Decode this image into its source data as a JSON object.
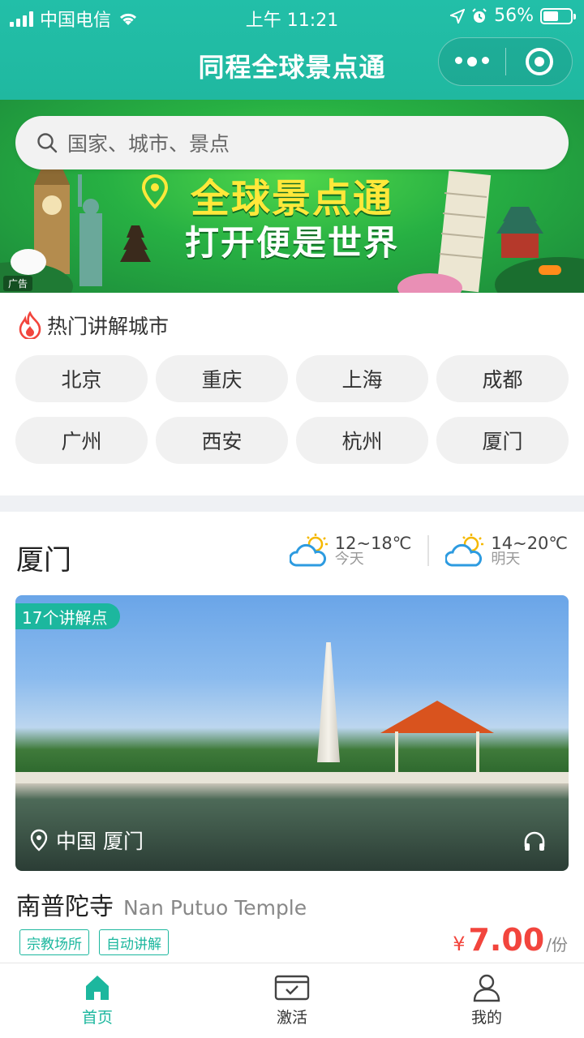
{
  "status_bar": {
    "carrier": "中国电信",
    "time": "上午 11:21",
    "battery": "56%"
  },
  "nav": {
    "title": "同程全球景点通"
  },
  "search": {
    "placeholder": "国家、城市、景点"
  },
  "banner": {
    "title_line1": "全球景点通",
    "title_line2": "打开便是世界",
    "ad_label": "广告"
  },
  "hot_cities": {
    "heading": "热门讲解城市",
    "cities": [
      "北京",
      "重庆",
      "上海",
      "成都",
      "广州",
      "西安",
      "杭州",
      "厦门"
    ]
  },
  "city_section": {
    "name": "厦门",
    "weather": [
      {
        "temp": "12~18℃",
        "day": "今天",
        "icon": "partly-cloudy-icon"
      },
      {
        "temp": "14~20℃",
        "day": "明天",
        "icon": "partly-cloudy-icon"
      }
    ],
    "card": {
      "spots_badge": "17个讲解点",
      "location": "中国  厦门",
      "title_cn": "南普陀寺",
      "title_en": "Nan Putuo Temple",
      "tags": [
        "宗教场所",
        "自动讲解"
      ],
      "price_currency": "¥",
      "price": "7.00",
      "price_unit": "/份"
    }
  },
  "tabbar": {
    "items": [
      "首页",
      "激活",
      "我的"
    ],
    "active": "首页"
  },
  "colors": {
    "brand": "#1cb79e",
    "price": "#f2453d"
  }
}
